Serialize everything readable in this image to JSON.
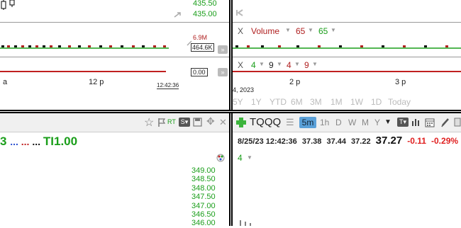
{
  "top_left": {
    "price_top_1": "435.50",
    "price_top_2": "435.00",
    "vol_label_1": "6.9M",
    "vol_label_2": "464.6K",
    "ind_label": "0.00",
    "time_label_a": "a",
    "time_label_12p": "12 p",
    "time_stamp": "12:42:36"
  },
  "top_right": {
    "row1": {
      "x": "X",
      "name": "Volume",
      "v1": "65",
      "v2": "65"
    },
    "row2": {
      "x": "X",
      "a": "4",
      "b": "9",
      "c": "4",
      "d": "9"
    },
    "time_label_2p": "2 p",
    "time_label_3p": "3 p",
    "date_label": "4, 2023",
    "ranges": [
      "5Y",
      "1Y",
      "YTD",
      "6M",
      "3M",
      "1M",
      "1W",
      "1D",
      "Today"
    ]
  },
  "bottom_left": {
    "toolbar_rt": "RT",
    "title_prefix": "3",
    "title_dots": "... ... ...",
    "title_text": "TI1.00",
    "prices": [
      "349.00",
      "348.50",
      "348.00",
      "347.50",
      "347.00",
      "346.50",
      "346.00"
    ]
  },
  "bottom_right": {
    "symbol": "TQQQ",
    "intervals": [
      "5m",
      "1h",
      "D",
      "W",
      "M",
      "Y"
    ],
    "active_interval": "5m",
    "quote": {
      "datetime": "8/25/23 12:42:36",
      "open": "37.38",
      "high": "37.44",
      "low": "37.22",
      "last": "37.27",
      "change": "-0.11",
      "pct": "-0.29%"
    },
    "study_value": "4"
  }
}
